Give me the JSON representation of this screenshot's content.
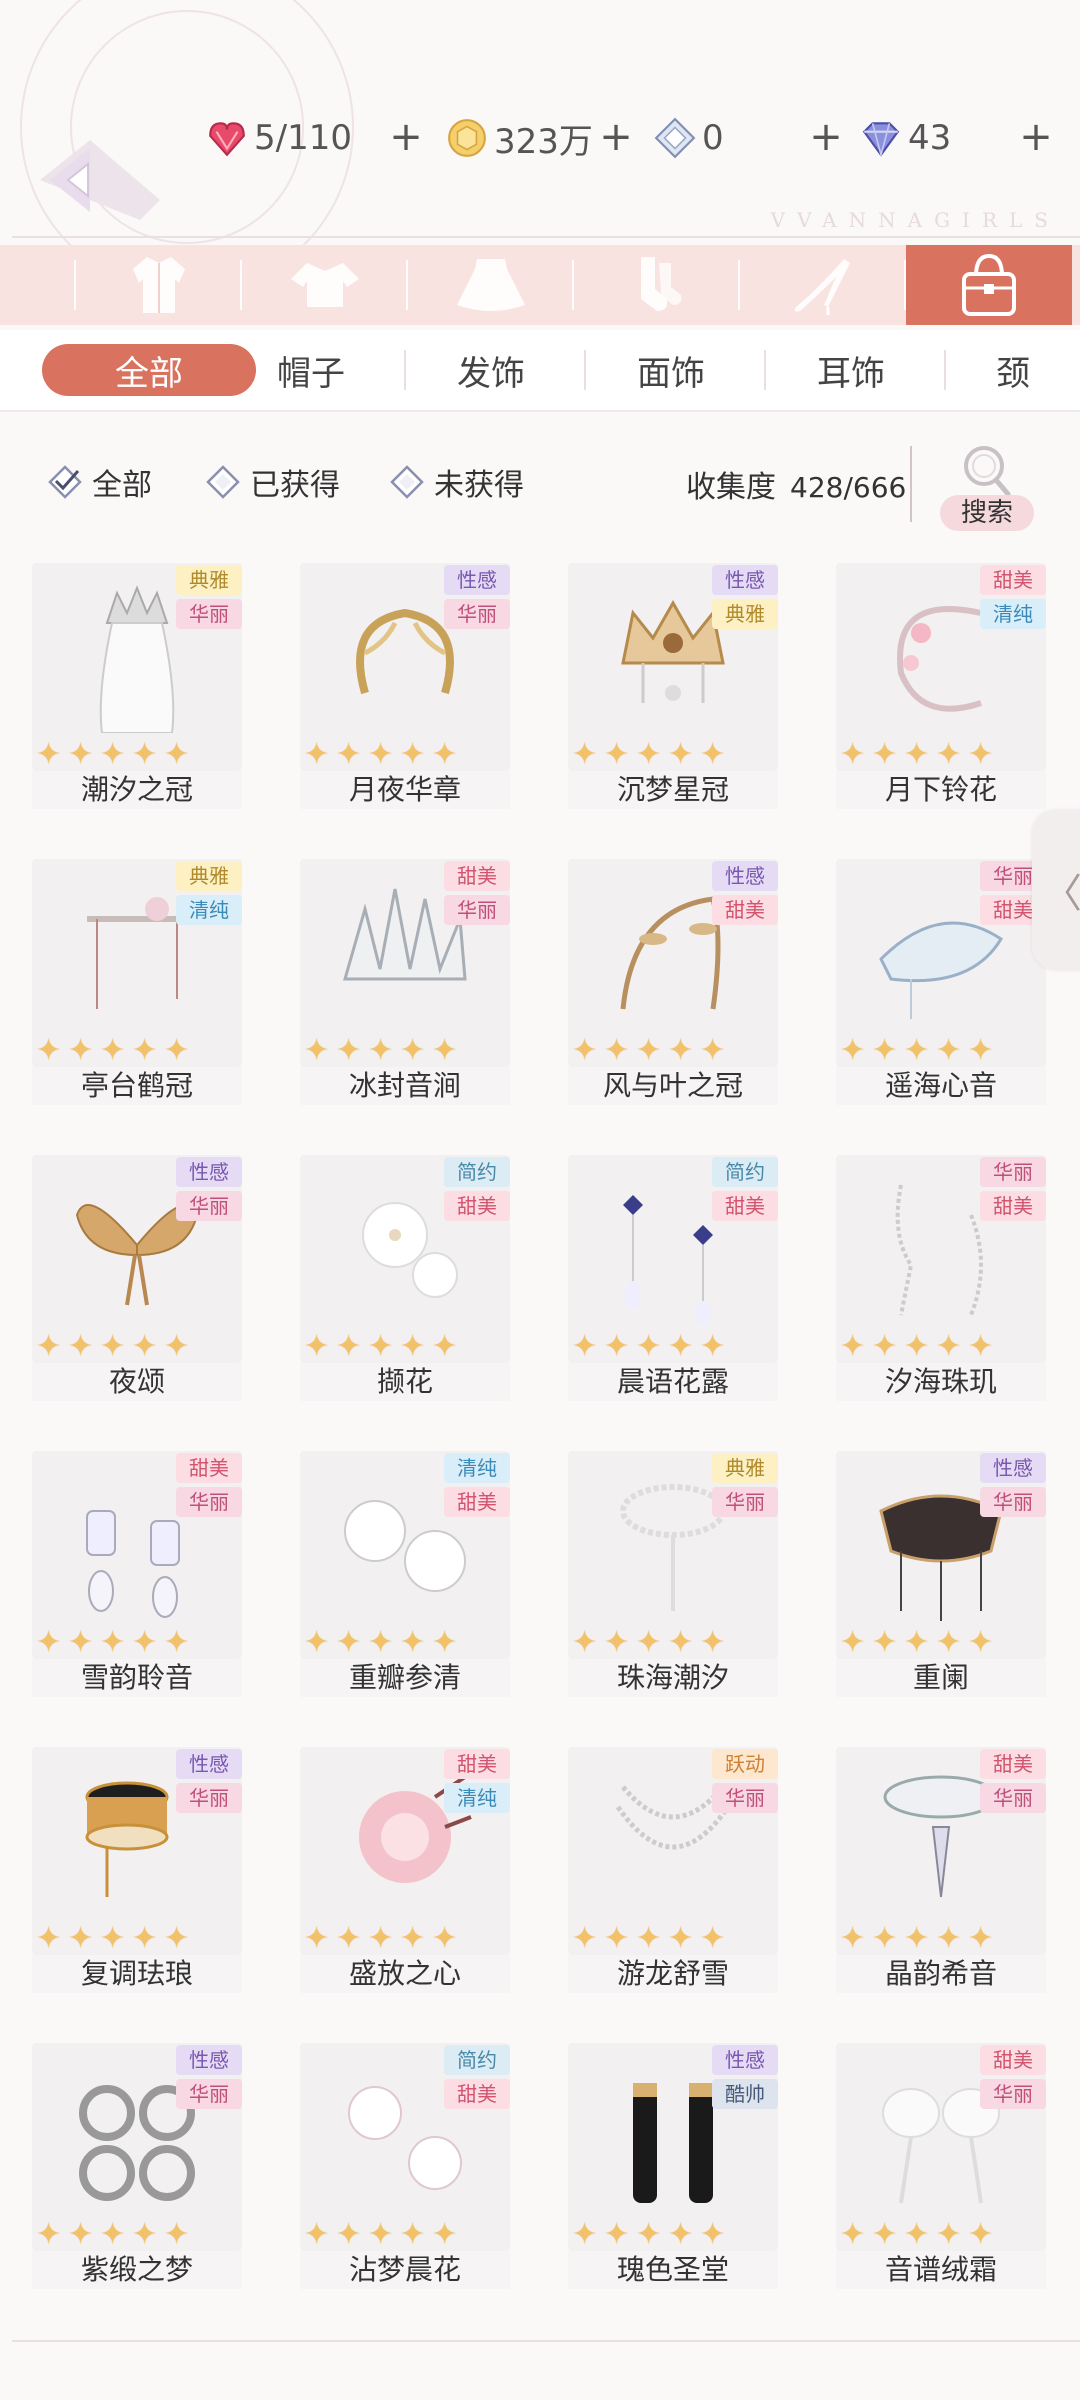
{
  "resources": {
    "stamina": "5/110",
    "coins": "323万",
    "crystal": "0",
    "diamond": "43",
    "plus": "+"
  },
  "watermark": "VVANNAGIRLS",
  "categories": [
    "coat-icon",
    "top-icon",
    "skirt-icon",
    "socks-icon",
    "shoes-icon",
    "bag-icon"
  ],
  "subtabs": [
    "全部",
    "帽子",
    "发饰",
    "面饰",
    "耳饰",
    "颈"
  ],
  "filters": [
    "全部",
    "已获得",
    "未获得"
  ],
  "collection": {
    "label": "收集度",
    "value": "428/666"
  },
  "search_label": "搜索",
  "side_handle": "〈",
  "star": "✦",
  "tag_colors": {
    "典雅": [
      "#fdf1c4",
      "#b08a2a"
    ],
    "华丽": [
      "#f8d8e3",
      "#c0507a"
    ],
    "性感": [
      "#e5dbf4",
      "#7a58b0"
    ],
    "甜美": [
      "#fbdde3",
      "#d2546e"
    ],
    "清纯": [
      "#d9eef8",
      "#3a8bb8"
    ],
    "简约": [
      "#dcecf4",
      "#4a88a8"
    ],
    "跃动": [
      "#fde7cf",
      "#d08030"
    ],
    "酷帅": [
      "#dde4ee",
      "#4a5a7a"
    ]
  },
  "items": [
    {
      "name": "潮汐之冠",
      "tags": [
        "典雅",
        "华丽"
      ],
      "art": "crown-veil"
    },
    {
      "name": "月夜华章",
      "tags": [
        "性感",
        "华丽"
      ],
      "art": "gold-wreath"
    },
    {
      "name": "沉梦星冠",
      "tags": [
        "性感",
        "典雅"
      ],
      "art": "gold-crown"
    },
    {
      "name": "月下铃花",
      "tags": [
        "甜美",
        "清纯"
      ],
      "art": "pink-wreath"
    },
    {
      "name": "亭台鹤冠",
      "tags": [
        "典雅",
        "清纯"
      ],
      "art": "crane-crown"
    },
    {
      "name": "冰封音涧",
      "tags": [
        "甜美",
        "华丽"
      ],
      "art": "ice-crown"
    },
    {
      "name": "风与叶之冠",
      "tags": [
        "性感",
        "甜美"
      ],
      "art": "leaf-wreath"
    },
    {
      "name": "遥海心音",
      "tags": [
        "华丽",
        "甜美"
      ],
      "art": "blue-headpiece"
    },
    {
      "name": "夜颂",
      "tags": [
        "性感",
        "华丽"
      ],
      "art": "gold-wings"
    },
    {
      "name": "撷花",
      "tags": [
        "简约",
        "甜美"
      ],
      "art": "white-flowers"
    },
    {
      "name": "晨语花露",
      "tags": [
        "简约",
        "甜美"
      ],
      "art": "blue-earrings"
    },
    {
      "name": "汐海珠玑",
      "tags": [
        "华丽",
        "甜美"
      ],
      "art": "pearl-chains"
    },
    {
      "name": "雪韵聆音",
      "tags": [
        "甜美",
        "华丽"
      ],
      "art": "crystal-earrings"
    },
    {
      "name": "重瓣参清",
      "tags": [
        "清纯",
        "甜美"
      ],
      "art": "flower-studs"
    },
    {
      "name": "珠海潮汐",
      "tags": [
        "典雅",
        "华丽"
      ],
      "art": "pearl-necklace"
    },
    {
      "name": "重阑",
      "tags": [
        "性感",
        "华丽"
      ],
      "art": "black-necklace"
    },
    {
      "name": "复调珐琅",
      "tags": [
        "性感",
        "华丽"
      ],
      "art": "enamel-choker"
    },
    {
      "name": "盛放之心",
      "tags": [
        "甜美",
        "清纯"
      ],
      "art": "pink-corsage"
    },
    {
      "name": "游龙舒雪",
      "tags": [
        "跃动",
        "华丽"
      ],
      "art": "layered-necklace"
    },
    {
      "name": "晶韵希音",
      "tags": [
        "甜美",
        "华丽"
      ],
      "art": "crystal-choker"
    },
    {
      "name": "紫缎之梦",
      "tags": [
        "性感",
        "华丽"
      ],
      "art": "silver-bands"
    },
    {
      "name": "沾梦晨花",
      "tags": [
        "简约",
        "甜美"
      ],
      "art": "flower-cuffs"
    },
    {
      "name": "瑰色圣堂",
      "tags": [
        "性感",
        "酷帅"
      ],
      "art": "black-gloves"
    },
    {
      "name": "音谱绒霜",
      "tags": [
        "甜美",
        "华丽"
      ],
      "art": "fur-cuffs"
    }
  ]
}
